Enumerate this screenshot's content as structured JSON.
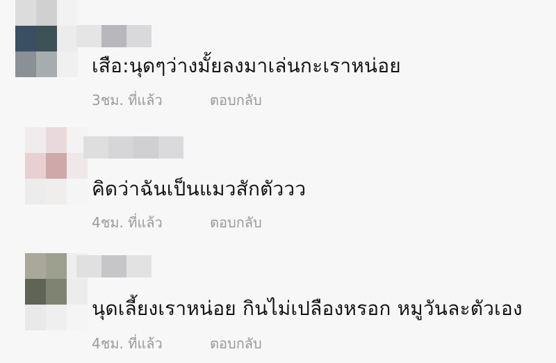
{
  "comments": [
    {
      "text": "เสือ:นุดๆว่างมั้ยลงมาเล่นกะเราหน่อย",
      "time": "3ชม. ที่แล้ว",
      "reply": "ตอบกลับ",
      "avatar_colors": [
        "#dcdcdc",
        "#d0d0d0",
        "#f2f2f2",
        "#3b4f62",
        "#3d5256",
        "#ececec",
        "#8b9096",
        "#a7acae",
        "#f0f0f0"
      ],
      "name_colors": [
        "#e5e5e5",
        "#b7b7bc",
        "#d9d9db"
      ]
    },
    {
      "text": "คิดว่าฉันเป็นแมวสักตัววว",
      "time": "4ชม. ที่แล้ว",
      "reply": "ตอบกลับ",
      "avatar_colors": [
        "#f0ecee",
        "#ead9dc",
        "#f4f2f3",
        "#e8cfd2",
        "#cfa9a9",
        "#f0e8e8",
        "#ececec",
        "#f0eded",
        "#f5f5f5"
      ],
      "name_colors": [
        "#dedede",
        "#d6d6d8",
        "#d0d0d2",
        "#dadadc"
      ]
    },
    {
      "text": "นุดเลี้ยงเราหน่อย กินไม่เปลืองหรอก หมูวันละตัวเอง",
      "time": "4ชม. ที่แล้ว",
      "reply": "ตอบกลับ",
      "avatar_colors": [
        "#a9a89a",
        "#9d9f8f",
        "#eeeeee",
        "#5f6456",
        "#7f8371",
        "#ececec",
        "#e9e9e9",
        "#efefef",
        "#f5f5f5"
      ],
      "name_colors": [
        "#e0e0e0",
        "#c6c6c9",
        "#e2e2e2"
      ]
    }
  ]
}
